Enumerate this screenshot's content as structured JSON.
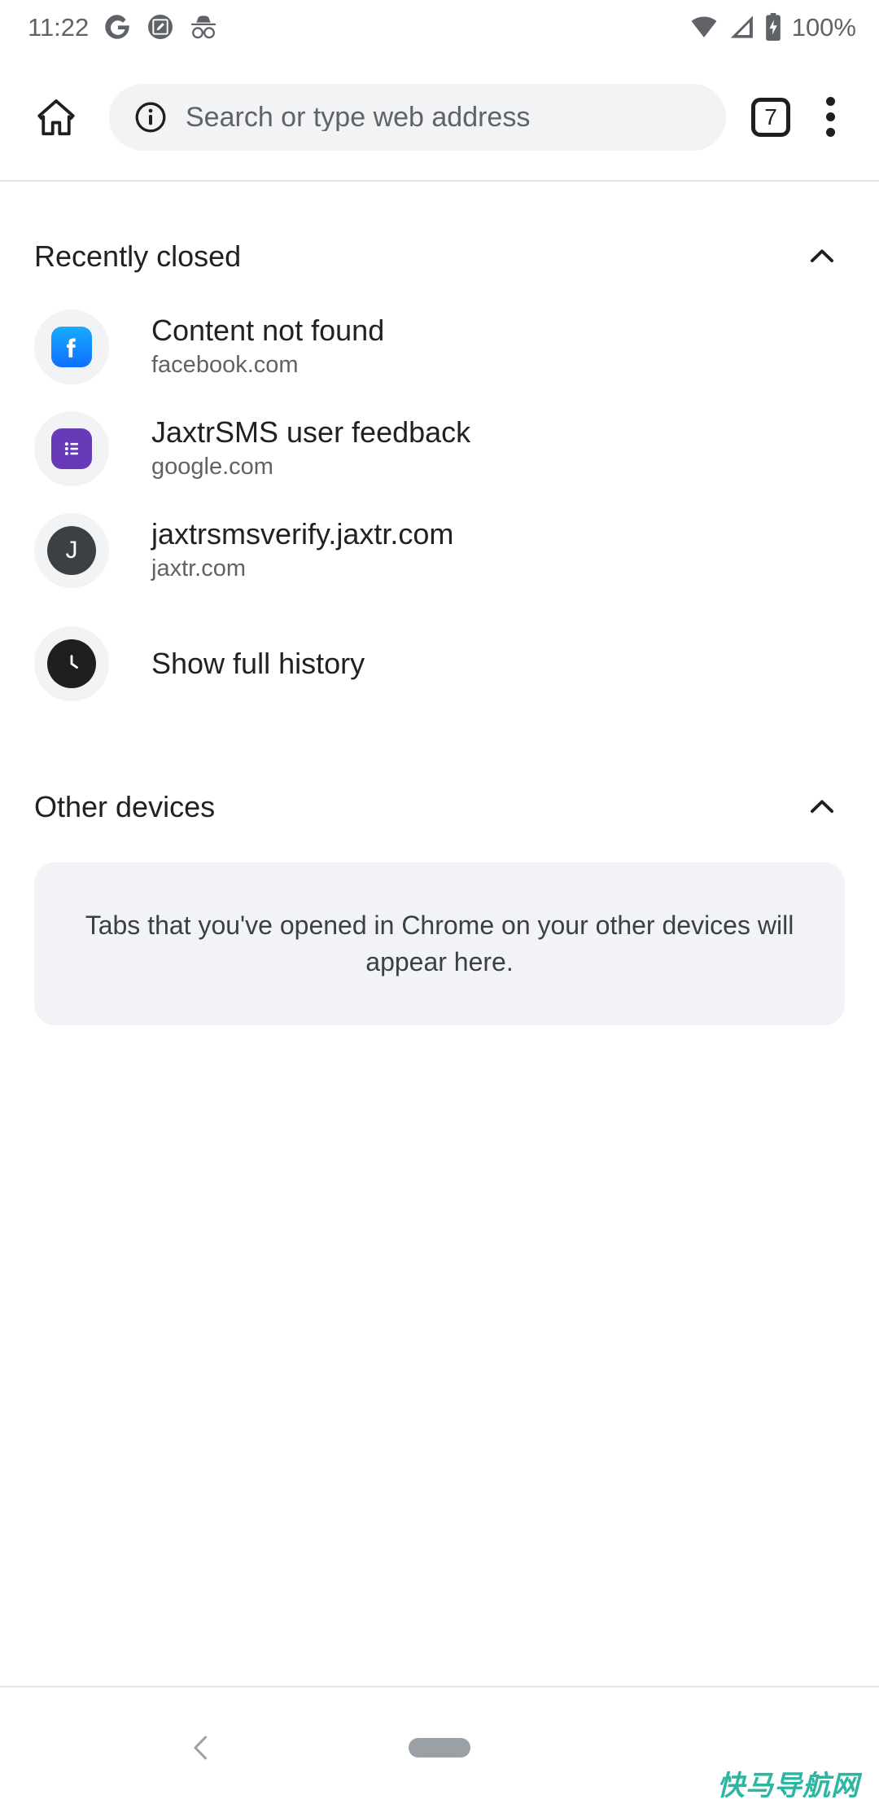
{
  "status_bar": {
    "time": "11:22",
    "battery_percent": "100%",
    "icons": [
      "google-icon",
      "screenshot-markup-icon",
      "incognito-icon",
      "wifi-icon",
      "cellular-signal-icon",
      "battery-charging-icon"
    ]
  },
  "toolbar": {
    "home_label": "Home",
    "omnibox_placeholder": "Search or type web address",
    "tab_count": "7",
    "menu_label": "More options"
  },
  "sections": {
    "recently_closed": {
      "title": "Recently closed",
      "collapsed": false,
      "items": [
        {
          "title": "Content not found",
          "domain": "facebook.com",
          "icon": "facebook-favicon"
        },
        {
          "title": "JaxtrSMS user feedback",
          "domain": "google.com",
          "icon": "google-forms-favicon"
        },
        {
          "title": "jaxtrsmsverify.jaxtr.com",
          "domain": "jaxtr.com",
          "icon": "letter-favicon",
          "letter": "J"
        }
      ],
      "show_full_history": {
        "label": "Show full history",
        "icon": "clock-icon"
      }
    },
    "other_devices": {
      "title": "Other devices",
      "collapsed": false,
      "empty_message": "Tabs that you've opened in Chrome on your other devices will appear here."
    }
  },
  "nav_bar": {
    "back_label": "Back",
    "home_pill_label": "Home gesture pill"
  },
  "watermark": {
    "text": "快马导航网"
  },
  "colors": {
    "accent_facebook": "#1877F2",
    "accent_forms": "#673AB7",
    "surface": "#F1F3F4",
    "card": "#F1F3F6",
    "text_primary": "#202124",
    "text_secondary": "#5F6368",
    "watermark": "#2CB5A0"
  }
}
